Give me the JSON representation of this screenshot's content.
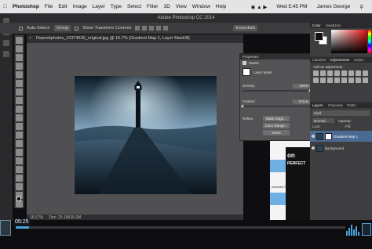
{
  "menubar": {
    "apple": "",
    "app": "Photoshop",
    "items": [
      "File",
      "Edit",
      "Image",
      "Layer",
      "Type",
      "Select",
      "Filter",
      "3D",
      "View",
      "Window",
      "Help"
    ],
    "clock": "Wed 5:45 PM",
    "user": "James George"
  },
  "window": {
    "title": "Adobe Photoshop CC 2014"
  },
  "options": {
    "auto_select": "Auto-Select:",
    "auto_select_value": "Group",
    "show_transform": "Show Transform Controls",
    "workspace": "Essentials"
  },
  "document": {
    "tab": "Depositphotos_12374530_original.jpg @ 16.7% (Gradient Map 1, Layer Mask/8)",
    "status": "16.67%",
    "doc_info": "Doc: 20.1M/39.2M"
  },
  "properties": {
    "header": "Properties",
    "section": "Masks",
    "mask_type": "Layer Mask",
    "density_label": "Density:",
    "density_value": "100%",
    "density_level": 1.0,
    "feather_label": "Feather:",
    "feather_value": "0.0 px",
    "feather_level": 0.0,
    "refine_label": "Refine:",
    "btn_mask_edge": "Mask Edge...",
    "btn_color_range": "Color Range...",
    "btn_invert": "Invert"
  },
  "color_panel": {
    "tabs": [
      "Color",
      "Swatches"
    ],
    "fg_color": "#111111",
    "bg_color": "#ffffff"
  },
  "adjustments_panel": {
    "tabs": [
      "Libraries",
      "Adjustments",
      "Styles"
    ],
    "title": "Add an adjustment"
  },
  "layers_panel": {
    "tabs": [
      "Layers",
      "Channels",
      "Paths"
    ],
    "kind": "Kind",
    "blend": "Normal",
    "opacity_label": "Opacity:",
    "lock_label": "Lock:",
    "fill_label": "Fill:",
    "layers": [
      {
        "name": "Gradient Map 1",
        "active": true
      },
      {
        "name": "Background",
        "active": false
      }
    ]
  },
  "browser_preview": {
    "logo": "on",
    "tagline": "PERFECT",
    "snippet": "ombined for 3"
  },
  "player": {
    "time": "05:25",
    "progress": 0.04,
    "accent": "#4aa6e0"
  }
}
